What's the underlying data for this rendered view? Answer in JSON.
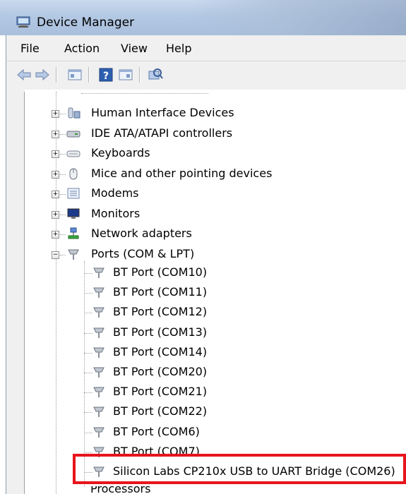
{
  "window": {
    "title": "Device Manager"
  },
  "menu": [
    "File",
    "Action",
    "View",
    "Help"
  ],
  "toolbar": {
    "buttons": [
      "back-icon",
      "forward-icon",
      "properties-icon",
      "help-icon",
      "show-hide-icon",
      "scan-hardware-icon"
    ]
  },
  "tree": {
    "categories": [
      {
        "label": "Human Interface Devices",
        "icon": "hid-icon"
      },
      {
        "label": "IDE ATA/ATAPI controllers",
        "icon": "ide-icon"
      },
      {
        "label": "Keyboards",
        "icon": "keyboard-icon"
      },
      {
        "label": "Mice and other pointing devices",
        "icon": "mouse-icon"
      },
      {
        "label": "Modems",
        "icon": "modem-icon"
      },
      {
        "label": "Monitors",
        "icon": "monitor-icon"
      },
      {
        "label": "Network adapters",
        "icon": "network-icon"
      },
      {
        "label": "Ports (COM & LPT)",
        "icon": "port-icon"
      }
    ],
    "ports": [
      "BT Port (COM10)",
      "BT Port (COM11)",
      "BT Port (COM12)",
      "BT Port (COM13)",
      "BT Port (COM14)",
      "BT Port (COM20)",
      "BT Port (COM21)",
      "BT Port (COM22)",
      "BT Port (COM6)",
      "BT Port (COM7)",
      "Silicon Labs CP210x USB to UART Bridge (COM26)"
    ],
    "next_category": "Processors"
  },
  "colors": {
    "highlight": "#e8141b",
    "titlebar": "#b3c8e3"
  }
}
